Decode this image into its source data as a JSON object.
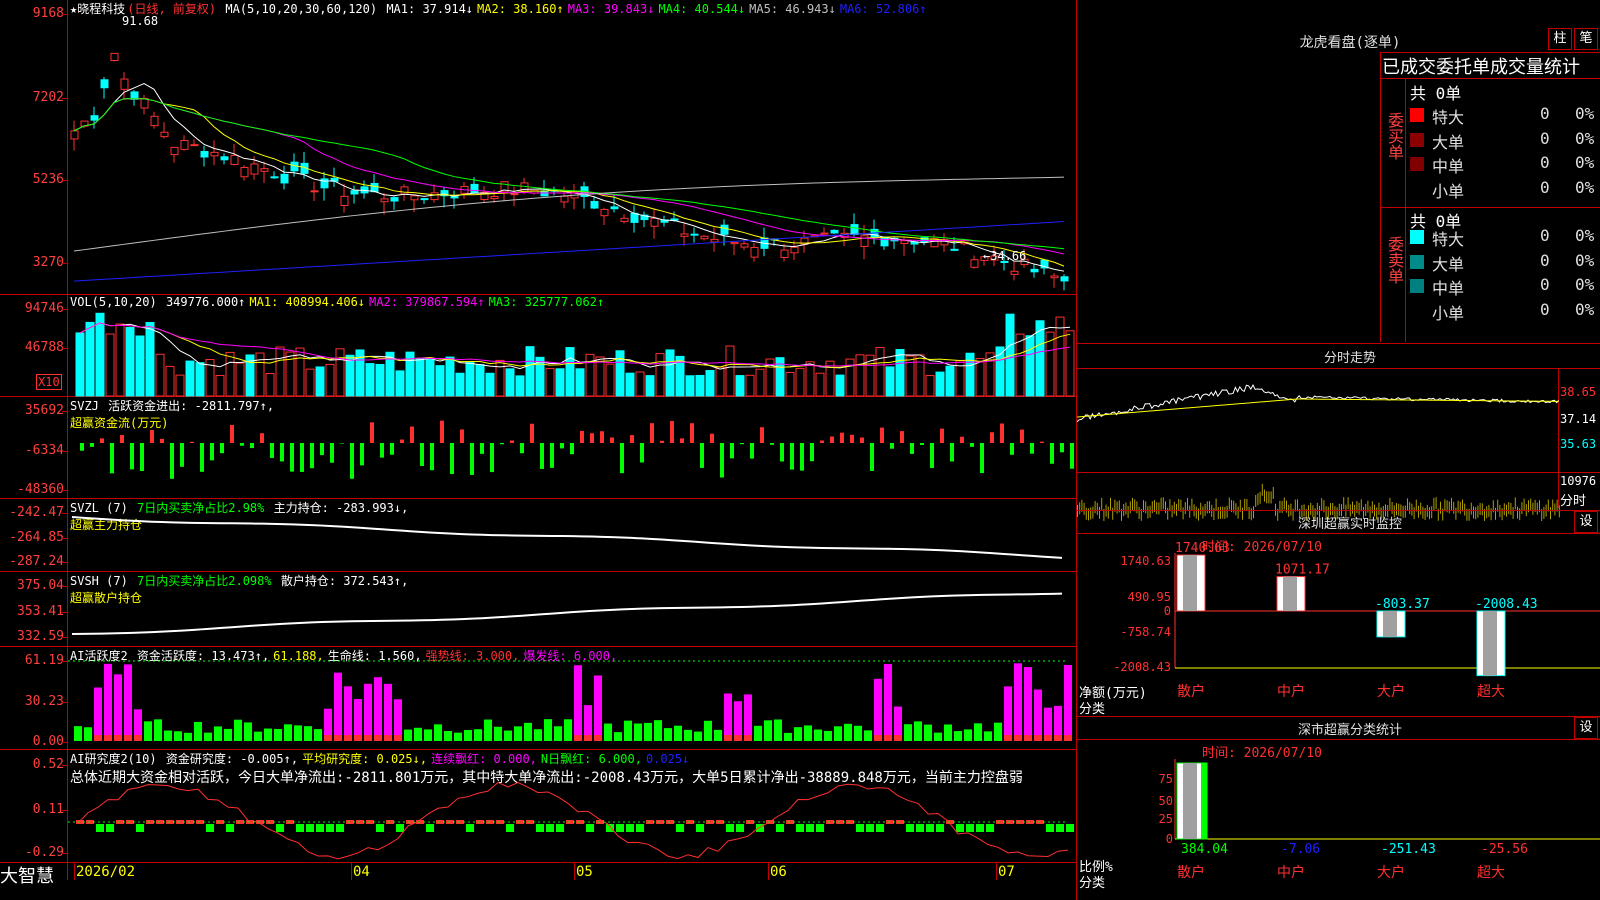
{
  "stock": {
    "name": "★晓程科技",
    "period": "(日线, 前复权)"
  },
  "colors": {
    "up": "#ff3030",
    "down": "#00ffff",
    "grid": "#c00000",
    "ma1": "#ffffff",
    "ma2": "#ffff00",
    "ma3": "#ff00ff",
    "ma4": "#00ff00",
    "ma5": "#c0c0c0",
    "ma6": "#2020ff"
  },
  "main": {
    "ma_label": "MA(5,10,20,30,60,120)",
    "ma": [
      {
        "label": "MA1: 37.914↓",
        "color": "#ffffff"
      },
      {
        "label": "MA2: 38.160↑",
        "color": "#ffff00"
      },
      {
        "label": "MA3: 39.843↓",
        "color": "#ff00ff"
      },
      {
        "label": "MA4: 40.544↓",
        "color": "#00ff00"
      },
      {
        "label": "MA5: 46.943↓",
        "color": "#c0c0c0"
      },
      {
        "label": "MA6: 52.806↑",
        "color": "#2020ff"
      }
    ],
    "y_ticks": [
      "9168",
      "7202",
      "5236",
      "3270"
    ],
    "high_label": "91.68",
    "low_label": "←34.66"
  },
  "vol": {
    "head": "VOL(5,10,20)",
    "vals": [
      {
        "label": "349776.000↑",
        "color": "#ffffff"
      },
      {
        "label": "MA1: 408994.406↓",
        "color": "#ffff00"
      },
      {
        "label": "MA2: 379867.594↑",
        "color": "#ff00ff"
      },
      {
        "label": "MA3: 325777.062↑",
        "color": "#00ff00"
      }
    ],
    "y_ticks": [
      "94746",
      "46788"
    ],
    "unit": "X10"
  },
  "svzj": {
    "head": "SVZJ",
    "line1": "活跃资金进出: -2811.797↑,",
    "line2": "超赢资金流(万元)",
    "y_ticks": [
      "35692",
      "-6334",
      "-48360"
    ]
  },
  "svzl": {
    "head": "SVZL (7)",
    "green": "7日内买卖净占比2.98%",
    "white": "主力持仓: -283.993↓,",
    "line2": "超赢主力持仓",
    "y_ticks": [
      "-242.47",
      "-264.85",
      "-287.24"
    ]
  },
  "svsh": {
    "head": "SVSH (7)",
    "green": "7日内买卖净占比2.098%",
    "white": "散户持仓: 372.543↑,",
    "line2": "超赢散户持仓",
    "y_ticks": [
      "375.04",
      "353.41",
      "332.59"
    ]
  },
  "ai_act": {
    "head": "AI活跃度2",
    "vals": [
      {
        "label": "资金活跃度: 13.473↑,",
        "color": "#ffffff"
      },
      {
        "label": "61.188,",
        "color": "#ffff00"
      },
      {
        "label": "生命线: 1.560,",
        "color": "#ffffff"
      },
      {
        "label": "强势线: 3.000,",
        "color": "#ff3030"
      },
      {
        "label": "爆发线: 6.000,",
        "color": "#ff00ff"
      }
    ],
    "y_ticks": [
      "61.19",
      "30.23",
      "0.00"
    ]
  },
  "ai_res": {
    "head": "AI研究度2(10)",
    "vals": [
      {
        "label": "资金研究度: -0.005↑,",
        "color": "#ffffff"
      },
      {
        "label": "平均研究度: 0.025↓,",
        "color": "#ffff00"
      },
      {
        "label": "连续飘红: 0.000,",
        "color": "#ff00ff"
      },
      {
        "label": "N日飘红: 6.000,",
        "color": "#00ff00"
      },
      {
        "label": "0.025↓",
        "color": "#2020ff"
      }
    ],
    "summary": "总体近期大资金相对活跃，今日大单净流出:-2811.801万元，其中特大单净流出:-2008.43万元，大单5日累计净出-38889.848万元，当前主力控盘弱",
    "y_ticks": [
      "0.52",
      "0.11",
      "-0.29"
    ]
  },
  "bottom": {
    "brand": "大智慧",
    "dates": [
      "2026/02",
      "04",
      "05",
      "06",
      "07"
    ]
  },
  "right": {
    "dragon_title": "龙虎看盘(逐单)",
    "btn1": "柱",
    "btn2": "笔",
    "ob_title": "已成交委托单成交量统计",
    "buy_label": "委买单",
    "sell_label": "委卖单",
    "buy_total": "共 0单",
    "sell_total": "共 0单",
    "buy_rows": [
      {
        "name": "特大",
        "count": "0",
        "pct": "0%",
        "color": "#ff0000"
      },
      {
        "name": "大单",
        "count": "0",
        "pct": "0%",
        "color": "#8b0000"
      },
      {
        "name": "中单",
        "count": "0",
        "pct": "0%",
        "color": "#800000"
      },
      {
        "name": "小单",
        "count": "0",
        "pct": "0%",
        "color": ""
      }
    ],
    "sell_rows": [
      {
        "name": "特大",
        "count": "0",
        "pct": "0%",
        "color": "#00ffff"
      },
      {
        "name": "大单",
        "count": "0",
        "pct": "0%",
        "color": "#008b8b"
      },
      {
        "name": "中单",
        "count": "0",
        "pct": "0%",
        "color": "#008080"
      },
      {
        "name": "小单",
        "count": "0",
        "pct": "0%",
        "color": ""
      }
    ],
    "intraday_title": "分时走势",
    "intraday_y": [
      "38.65",
      "37.14",
      "35.63"
    ],
    "intraday_vol": "10976",
    "intraday_vol_unit": "分时",
    "monitor_title": "深圳超赢实时监控",
    "monitor_time": "时间: 2026/07/10",
    "monitor_set": "设",
    "monitor_y": [
      "1740.63",
      "490.95",
      "0",
      "-758.74",
      "-2008.43"
    ],
    "monitor_ylabel1": "净额(万元)",
    "monitor_ylabel2": "分类",
    "monitor_bars": [
      {
        "cat": "散户",
        "value": 1740.63,
        "label": "1740.63"
      },
      {
        "cat": "中户",
        "value": 1071.17,
        "label": "1071.17"
      },
      {
        "cat": "大户",
        "value": -803.37,
        "label": "-803.37"
      },
      {
        "cat": "超大",
        "value": -2008.43,
        "label": "-2008.43"
      }
    ],
    "stat_title": "深市超赢分类统计",
    "stat_time": "时间: 2026/07/10",
    "stat_set": "设",
    "stat_y": [
      "75",
      "50",
      "25",
      "0"
    ],
    "stat_ylabel1": "比例%",
    "stat_ylabel2": "分类",
    "stat_bars": [
      {
        "cat": "散户",
        "value": 384.04,
        "label": "384.04",
        "color": "#00ff00"
      },
      {
        "cat": "中户",
        "value": -7.06,
        "label": "-7.06",
        "color": "#2020ff"
      },
      {
        "cat": "大户",
        "value": -251.43,
        "label": "-251.43",
        "color": "#00ffff"
      },
      {
        "cat": "超大",
        "value": -25.56,
        "label": "-25.56",
        "color": "#ff3030"
      }
    ]
  }
}
